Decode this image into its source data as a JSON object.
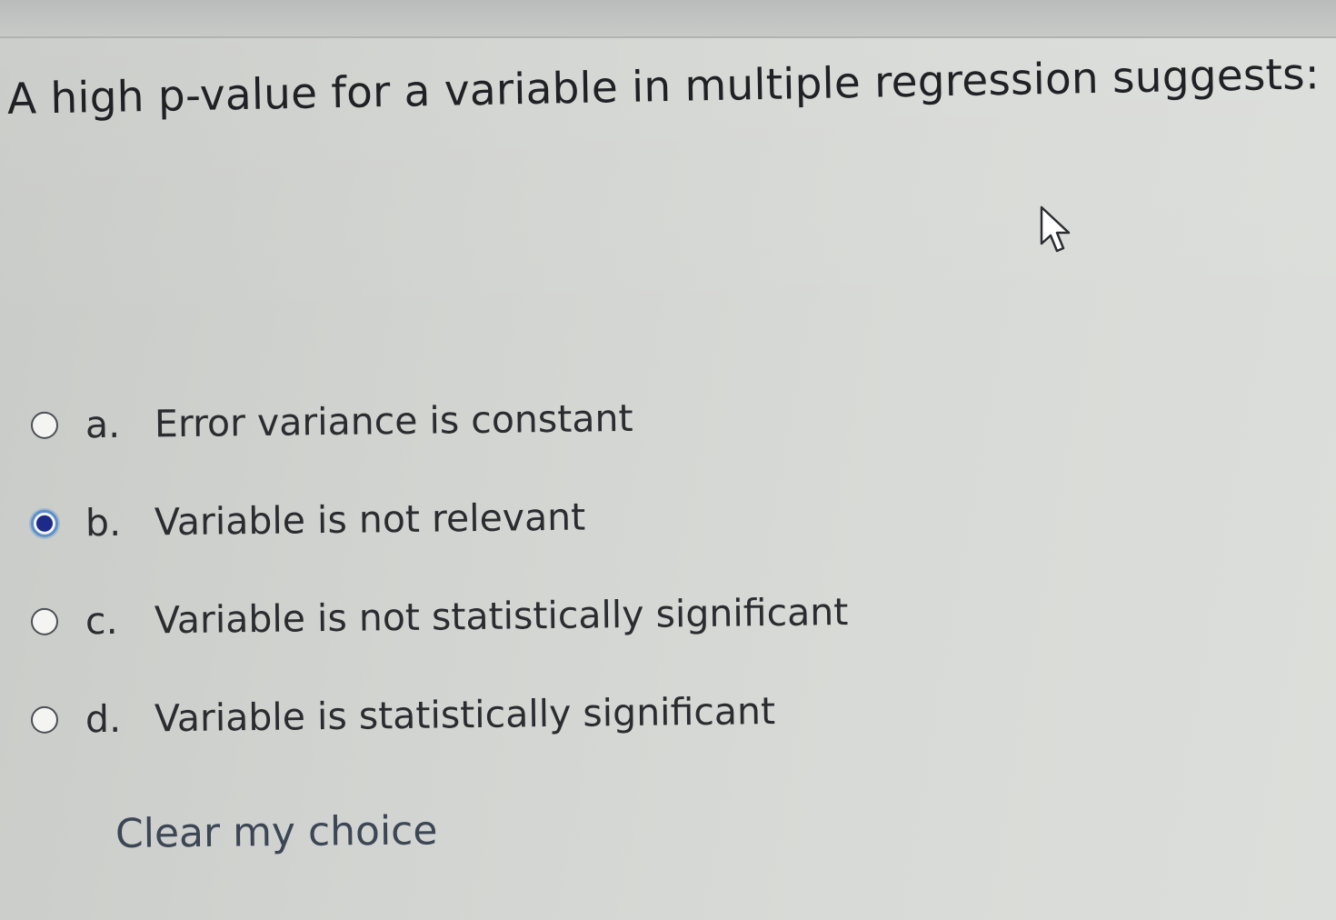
{
  "quiz": {
    "question_text": "A high p-value for a variable in multiple regression suggests:",
    "options": [
      {
        "letter": "a.",
        "text": "Error variance is constant",
        "selected": false
      },
      {
        "letter": "b.",
        "text": "Variable is not relevant",
        "selected": true
      },
      {
        "letter": "c.",
        "text": "Variable is not statistically significant",
        "selected": false
      },
      {
        "letter": "d.",
        "text": "Variable is statistically significant",
        "selected": false
      }
    ],
    "clear_label": "Clear my choice"
  },
  "icons": {
    "cursor": "mouse-pointer-icon",
    "radio_selected": "radio-checked-icon",
    "radio_unselected": "radio-unchecked-icon"
  },
  "colors": {
    "radio_selected_fill": "#1d2a8a",
    "radio_selected_ring": "#5a8fcc",
    "text": "#2a2c30"
  }
}
